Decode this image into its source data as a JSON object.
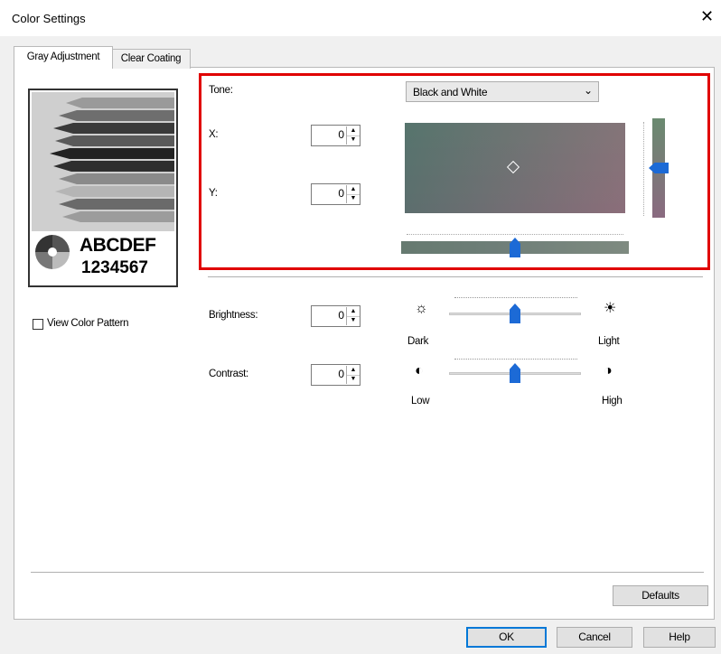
{
  "window": {
    "title": "Color Settings",
    "close_glyph": "✕"
  },
  "tabs": [
    {
      "label": "Gray Adjustment",
      "selected": true
    },
    {
      "label": "Clear Coating",
      "selected": false
    }
  ],
  "preview": {
    "sample_letters": "ABCDEF",
    "sample_digits": "1234567"
  },
  "view_color_pattern": {
    "label": "View Color Pattern",
    "checked": false
  },
  "tone": {
    "label": "Tone:",
    "selected": "Black and White",
    "x": {
      "label": "X:",
      "value": "0"
    },
    "y": {
      "label": "Y:",
      "value": "0"
    }
  },
  "brightness": {
    "label": "Brightness:",
    "value": "0",
    "low_label": "Dark",
    "high_label": "Light",
    "level": 0.5
  },
  "contrast": {
    "label": "Contrast:",
    "value": "0",
    "low_label": "Low",
    "high_label": "High",
    "level": 0.5
  },
  "buttons": {
    "defaults": "Defaults",
    "ok": "OK",
    "cancel": "Cancel",
    "help": "Help"
  },
  "icons": {
    "brightness_low": "sun-dim-icon",
    "brightness_high": "sun-bright-icon",
    "contrast_low": "contrast-low-icon",
    "contrast_high": "contrast-high-icon"
  },
  "colors": {
    "highlight_border": "#e00000",
    "slider_thumb": "#1c6ad6",
    "ok_focus": "#0078d7"
  }
}
